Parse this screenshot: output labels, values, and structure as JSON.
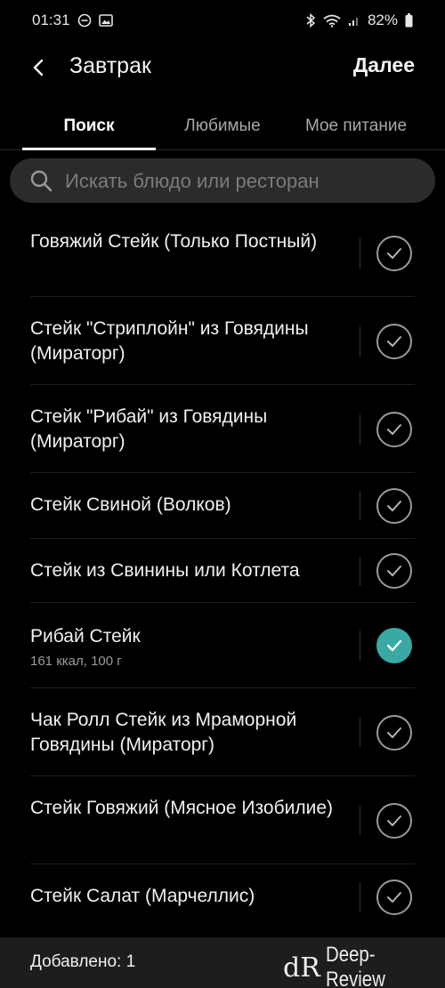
{
  "status_bar": {
    "time": "01:31",
    "battery": "82%",
    "icons": [
      "minus-circle-icon",
      "image-icon",
      "bluetooth-icon",
      "wifi-icon",
      "signal-icon",
      "battery-icon"
    ]
  },
  "header": {
    "title": "Завтрак",
    "next_label": "Далее"
  },
  "tabs": [
    {
      "label": "Поиск",
      "active": true
    },
    {
      "label": "Любимые",
      "active": false
    },
    {
      "label": "Мое питание",
      "active": false
    }
  ],
  "search": {
    "placeholder": "Искать блюдо или ресторан"
  },
  "items": [
    {
      "name": "Говяжий Стейк (Только Постный)",
      "selected": false
    },
    {
      "name": "Стейк \"Стриплойн\" из Говядины (Мираторг)",
      "selected": false
    },
    {
      "name": "Стейк \"Рибай\" из Говядины (Мираторг)",
      "selected": false
    },
    {
      "name": "Стейк Свиной (Волков)",
      "selected": false
    },
    {
      "name": "Стейк из Свинины или Котлета",
      "selected": false
    },
    {
      "name": "Рибай Стейк",
      "sub": "161 ккал, 100 г",
      "selected": true
    },
    {
      "name": "Чак Ролл Стейк из Мраморной Говядины (Мираторг)",
      "selected": false
    },
    {
      "name": "Стейк Говяжий (Мясное Изобилие)",
      "selected": false
    },
    {
      "name": "Стейк Салат (Марчеллис)",
      "selected": false
    }
  ],
  "footer": {
    "added_label": "Добавлено: 1"
  },
  "watermark": {
    "logo": "dR",
    "text": "Deep-Review"
  },
  "colors": {
    "accent": "#3aa9a4",
    "background": "#000000",
    "search_bg": "#2b2b2b",
    "bottom_bar": "#1d1d1d"
  }
}
